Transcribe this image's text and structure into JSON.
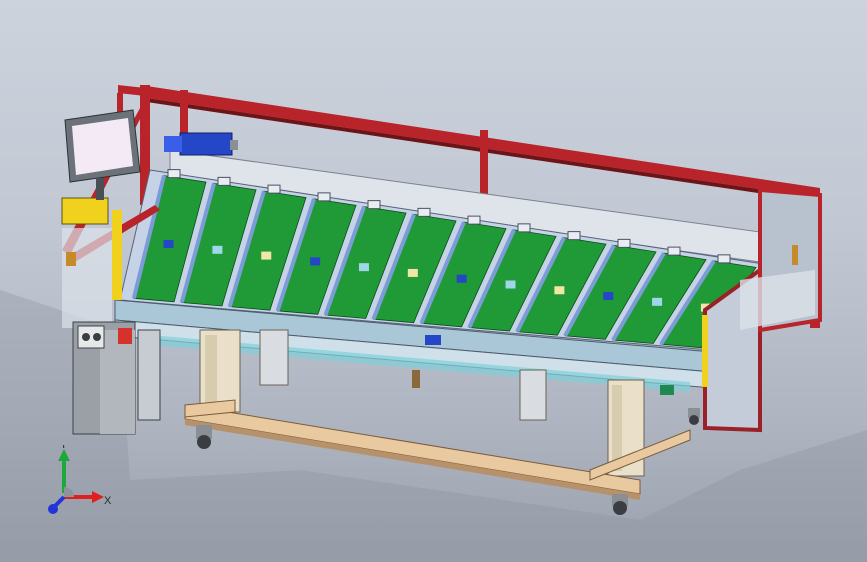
{
  "viewport": {
    "background_top": "#cdd3dd",
    "background_bottom": "#9aa1ad"
  },
  "model": {
    "frame_color": "#b8242a",
    "board_color": "#1f9a36",
    "rail_color": "#7c9cd8",
    "base_color": "#e8c9a0",
    "cabinet_color": "#9aa0a6",
    "motor_color": "#2447c8",
    "warning_color": "#f0d21e",
    "screen_color": "#f3eaf6",
    "board_count": 12
  },
  "triad": {
    "x_label": "X",
    "y_label": "Y",
    "x_color": "#e0201c",
    "y_color": "#1ea83a",
    "z_color": "#2233d8"
  }
}
